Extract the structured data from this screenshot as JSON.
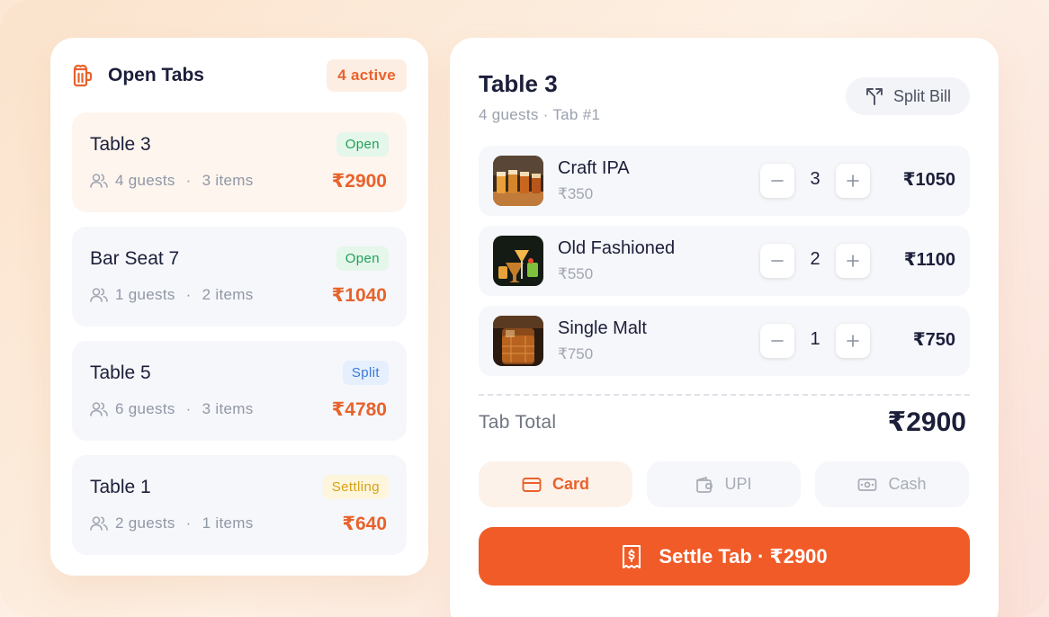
{
  "open_tabs": {
    "title": "Open Tabs",
    "active_badge": "4 active",
    "tabs": [
      {
        "name": "Table 3",
        "status": "Open",
        "guests": "4 guests",
        "items": "3 items",
        "total": "₹2900"
      },
      {
        "name": "Bar Seat 7",
        "status": "Open",
        "guests": "1 guests",
        "items": "2 items",
        "total": "₹1040"
      },
      {
        "name": "Table 5",
        "status": "Split",
        "guests": "6 guests",
        "items": "3 items",
        "total": "₹4780"
      },
      {
        "name": "Table 1",
        "status": "Settling",
        "guests": "2 guests",
        "items": "1 items",
        "total": "₹640"
      }
    ]
  },
  "detail": {
    "title": "Table 3",
    "subtitle": "4 guests · Tab #1",
    "split_label": "Split Bill",
    "items": [
      {
        "name": "Craft IPA",
        "price": "₹350",
        "qty": "3",
        "line_total": "₹1050"
      },
      {
        "name": "Old Fashioned",
        "price": "₹550",
        "qty": "2",
        "line_total": "₹1100"
      },
      {
        "name": "Single Malt",
        "price": "₹750",
        "qty": "1",
        "line_total": "₹750"
      }
    ],
    "total_label": "Tab Total",
    "total_value": "₹2900",
    "payment_options": [
      "Card",
      "UPI",
      "Cash"
    ],
    "selected_payment": "Card",
    "settle_label": "Settle Tab · ₹2900"
  },
  "colors": {
    "accent": "#f05b28",
    "accent_text": "#e8622c",
    "open": "#22a05a",
    "split": "#3a78d8",
    "settling": "#d9a114"
  },
  "icons": [
    "beer-mug-icon",
    "people-icon",
    "split-icon",
    "minus-icon",
    "plus-icon",
    "card-icon",
    "wallet-icon",
    "cash-icon",
    "receipt-icon"
  ]
}
